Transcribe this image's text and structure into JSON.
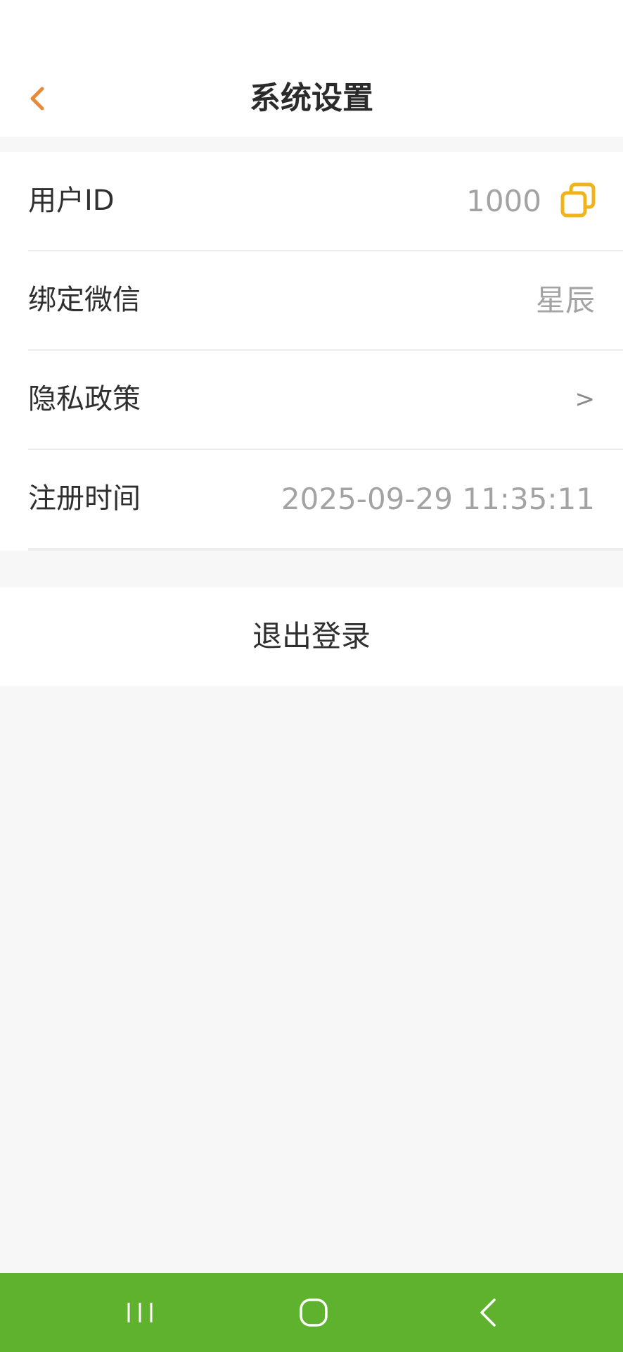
{
  "header": {
    "title": "系统设置",
    "back_icon": "chevron-left-icon",
    "accent_color": "#e8893a"
  },
  "settings": {
    "items": [
      {
        "label": "用户ID",
        "value": "1000",
        "icon": "copy-icon",
        "icon_color": "#f0b41b"
      },
      {
        "label": "绑定微信",
        "value": "星辰"
      },
      {
        "label": "隐私政策",
        "value": ">"
      },
      {
        "label": "注册时间",
        "value": "2025-09-29 11:35:11"
      }
    ]
  },
  "logout": {
    "label": "退出登录"
  },
  "system_nav": {
    "background": "#5fb22d",
    "buttons": [
      "recent-apps-icon",
      "home-icon",
      "back-icon"
    ]
  }
}
